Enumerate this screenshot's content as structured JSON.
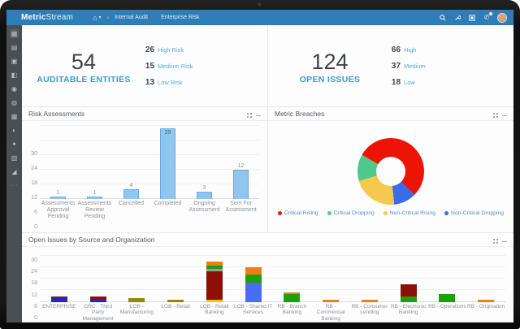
{
  "navbar": {
    "brand_bold": "Metric",
    "brand_regular": "Stream",
    "breadcrumb_separator": "›",
    "tabs": [
      {
        "label": "Internal Audit"
      },
      {
        "label": "Enterprise Risk"
      }
    ],
    "right_icons": [
      "search-icon",
      "tools-icon",
      "apps-icon",
      "phone-icon",
      "avatar"
    ]
  },
  "sidebar": {
    "items": [
      {
        "name": "dashboard"
      },
      {
        "name": "reports"
      },
      {
        "name": "documents"
      },
      {
        "name": "assessments"
      },
      {
        "name": "search"
      },
      {
        "name": "notifications"
      },
      {
        "name": "apps-grid"
      },
      {
        "name": "analytics"
      },
      {
        "name": "settings"
      },
      {
        "name": "library"
      },
      {
        "name": "trends"
      }
    ]
  },
  "kpis": [
    {
      "value": "54",
      "label": "AUDITABLE ENTITIES",
      "stats": [
        {
          "value": "26",
          "label": "High Risk"
        },
        {
          "value": "15",
          "label": "Medium Risk"
        },
        {
          "value": "13",
          "label": "Low Risk"
        }
      ]
    },
    {
      "value": "124",
      "label": "OPEN ISSUES",
      "stats": [
        {
          "value": "66",
          "label": "High"
        },
        {
          "value": "37",
          "label": "Medium"
        },
        {
          "value": "18",
          "label": "Low"
        }
      ]
    }
  ],
  "chart_data": [
    {
      "type": "bar",
      "title": "Risk Assessments",
      "categories": [
        "Assessments Approval Pending",
        "Assessments Review Pending",
        "Cancelled",
        "Completed",
        "Ongoing Assessment",
        "Sent For Assessment"
      ],
      "values": [
        1,
        1,
        4,
        29,
        3,
        12
      ],
      "bar_color": "#8ec6ef",
      "bar_border": "#69abdd",
      "ylim": [
        0,
        30
      ],
      "yticks": [
        0,
        6,
        12,
        18,
        24,
        30
      ],
      "grid": true
    },
    {
      "type": "pie",
      "title": "Metric Breaches",
      "donut": true,
      "start_deg": -60,
      "segments_clockwise": [
        {
          "label": "Critical Rising",
          "pct": 54
        },
        {
          "label": "Non-Critical Dropping",
          "pct": 11
        },
        {
          "label": "Non-Critical Rising",
          "pct": 22
        },
        {
          "label": "Critical Dropping",
          "pct": 13
        }
      ],
      "legend": [
        {
          "label": "Critical Rising",
          "color": "#ee1405"
        },
        {
          "label": "Critical Dropping",
          "color": "#4ec98c"
        },
        {
          "label": "Non-Critical Rising",
          "color": "#f4c94e"
        },
        {
          "label": "Non-Critical Dropping",
          "color": "#3a6ce8"
        }
      ],
      "legend_position": "bottom"
    },
    {
      "type": "bar",
      "subtype": "stacked",
      "title": "Open Issues by Source and Organization",
      "ylim": [
        0,
        30
      ],
      "yticks": [
        0,
        6,
        12,
        18,
        24,
        30
      ],
      "palette": {
        "navy": "#2525cf",
        "blue": "#4a6ef2",
        "darkred": "#8e1005",
        "olive": "#8f8c04",
        "yellow": "#eec224",
        "gray": "#9b9b9b",
        "green": "#219e0d",
        "orange": "#f07d12"
      },
      "categories": [
        "ENTERPRISE",
        "GRC - Third Party Management",
        "LOB - Manufacturing",
        "LOB - Retail",
        "LOB - Retail Banking",
        "LOB - Shared IT Services",
        "RB - Branch Banking",
        "RB - Commercial Banking",
        "RB - Consumer Lending",
        "RB - Electronic Banking",
        "RB - Operations",
        "RB - Origination"
      ],
      "stacks": [
        [
          {
            "c": "navy",
            "v": 2
          },
          {
            "c": "darkred",
            "v": 1
          }
        ],
        [
          {
            "c": "navy",
            "v": 1
          },
          {
            "c": "darkred",
            "v": 2
          }
        ],
        [
          {
            "c": "olive",
            "v": 2
          }
        ],
        [
          {
            "c": "olive",
            "v": 1
          }
        ],
        [
          {
            "c": "yellow",
            "v": 1
          },
          {
            "c": "darkred",
            "v": 15
          },
          {
            "c": "gray",
            "v": 1
          },
          {
            "c": "green",
            "v": 2
          },
          {
            "c": "orange",
            "v": 2
          }
        ],
        [
          {
            "c": "blue",
            "v": 10
          },
          {
            "c": "green",
            "v": 4
          },
          {
            "c": "orange",
            "v": 4
          }
        ],
        [
          {
            "c": "green",
            "v": 4
          },
          {
            "c": "orange",
            "v": 1
          }
        ],
        [
          {
            "c": "orange",
            "v": 1
          }
        ],
        [
          {
            "c": "orange",
            "v": 1
          }
        ],
        [
          {
            "c": "green",
            "v": 3
          },
          {
            "c": "darkred",
            "v": 6
          }
        ],
        [
          {
            "c": "green",
            "v": 4
          }
        ],
        [
          {
            "c": "orange",
            "v": 1
          }
        ]
      ]
    }
  ]
}
